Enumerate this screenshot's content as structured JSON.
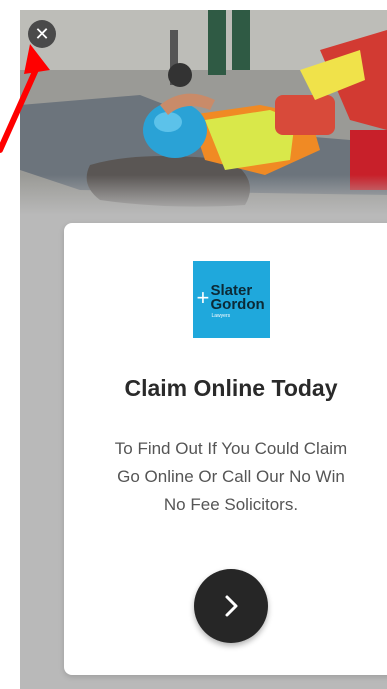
{
  "ad": {
    "close_glyph": "✕",
    "logo": {
      "line1": "Slater",
      "line2": "Gordon",
      "line3": "Lawyers",
      "color": "#1fa8dc"
    },
    "headline": "Claim Online Today",
    "body_line1": "To Find Out If You Could Claim",
    "body_line2": "Go Online Or Call Our No Win",
    "body_line3": "No Fee Solicitors.",
    "next_icon": "chevron-right-icon"
  },
  "annotation": {
    "arrow_color": "#ff0000"
  }
}
